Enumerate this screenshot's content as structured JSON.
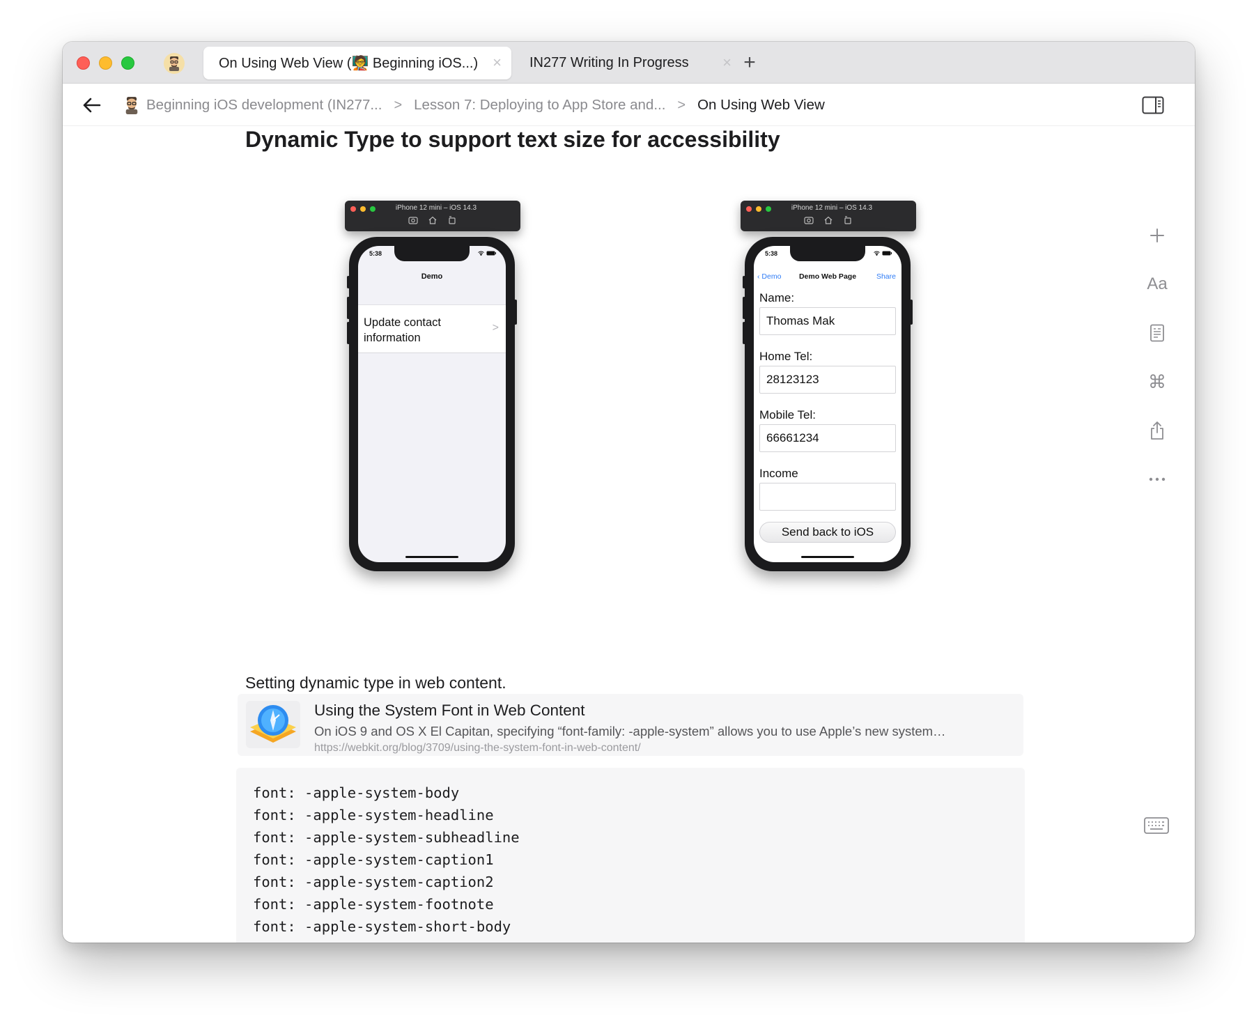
{
  "tabs": [
    {
      "label": "On Using Web View (🧑‍🏫 Beginning iOS...)",
      "active": true
    },
    {
      "label": "IN277 Writing In Progress",
      "active": false
    }
  ],
  "breadcrumb": [
    {
      "label": "Beginning iOS development (IN277..."
    },
    {
      "label": "Lesson 7: Deploying to App Store and..."
    },
    {
      "label": "On Using Web View"
    }
  ],
  "page": {
    "heading": "Dynamic Type to support text size for accessibility",
    "paragraph": "Setting dynamic type in web content."
  },
  "simulators": {
    "left": {
      "window_title": "iPhone 12 mini – iOS 14.3",
      "time": "5:38",
      "nav_title": "Demo",
      "cell_text": "Update contact information"
    },
    "right": {
      "window_title": "iPhone 12 mini – iOS 14.3",
      "time": "5:38",
      "back_label": "Demo",
      "nav_title": "Demo Web Page",
      "share_label": "Share",
      "form": {
        "name_label": "Name:",
        "name_value": "Thomas Mak",
        "home_label": "Home Tel:",
        "home_value": "28123123",
        "mobile_label": "Mobile Tel:",
        "mobile_value": "66661234",
        "income_label": "Income",
        "income_value": "",
        "button_label": "Send back to iOS"
      }
    }
  },
  "link_card": {
    "title": "Using the System Font in Web Content",
    "description": "On iOS 9 and OS X El Capitan, specifying “font-family: -apple-system” allows you to use Apple’s new system…",
    "url": "https://webkit.org/blog/3709/using-the-system-font-in-web-content/"
  },
  "code_lines": [
    "font: -apple-system-body",
    "font: -apple-system-headline",
    "font: -apple-system-subheadline",
    "font: -apple-system-caption1",
    "font: -apple-system-caption2",
    "font: -apple-system-footnote",
    "font: -apple-system-short-body"
  ],
  "side_tools": [
    "plus-icon",
    "text-format-icon",
    "outline-icon",
    "command-icon",
    "share-icon",
    "more-icon"
  ],
  "colors": {
    "accent_blue": "#2f7cf6",
    "traffic_red": "#fe5f57",
    "traffic_yellow": "#febc2e",
    "traffic_green": "#28c840"
  }
}
